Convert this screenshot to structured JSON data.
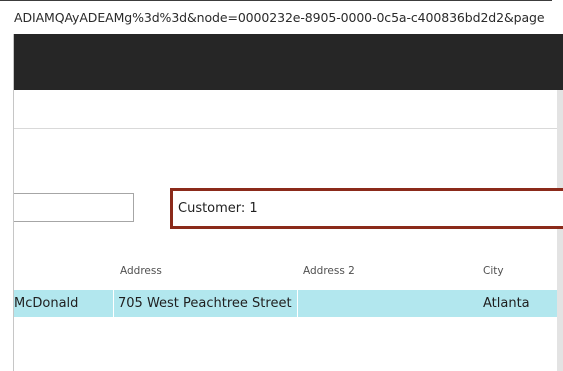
{
  "browser": {
    "url_fragment": "ADIAMQAyADEAMg%3d%3d&node=0000232e-8905-0000-0c5a-c400836bd2d2&page"
  },
  "filter": {
    "search_value": "",
    "customer_field_value": "Customer: 1"
  },
  "table": {
    "columns": [
      "Address",
      "Address 2",
      "City"
    ],
    "rows": [
      {
        "name": "McDonald",
        "address": "705 West Peachtree Street",
        "address2": "",
        "city": "Atlanta"
      }
    ]
  },
  "colors": {
    "header_bar": "#262626",
    "highlight_border": "#8b2a1a",
    "selected_row": "#b2e7ee"
  }
}
